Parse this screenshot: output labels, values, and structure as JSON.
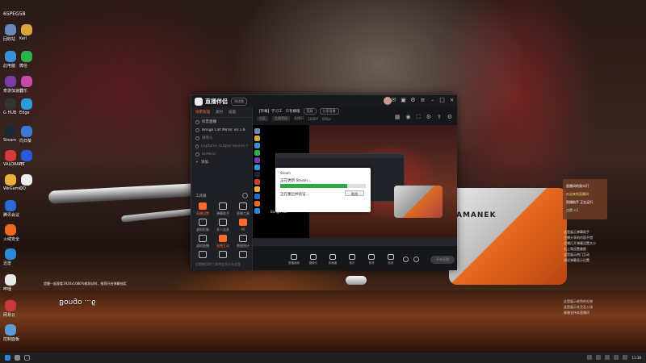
{
  "desktop": {
    "top_label": "65PEG5B",
    "icons": [
      {
        "label": "回收站",
        "color": "#6a87b8"
      },
      {
        "label": "Keil",
        "color": "#d8a53a"
      },
      {
        "label": "此电脑",
        "color": "#3a8fd8"
      },
      {
        "label": "微信",
        "color": "#2bb14a"
      },
      {
        "label": "奇游加速器",
        "color": "#7a3aa8"
      },
      {
        "label": "音乐",
        "color": "#c84aa8"
      },
      {
        "label": "G HUB",
        "color": "#333333"
      },
      {
        "label": "Edge",
        "color": "#2a9ad8"
      },
      {
        "label": "Steam",
        "color": "#1b2838"
      },
      {
        "label": "向日葵",
        "color": "#3a7ad8"
      },
      {
        "label": "VALORANT",
        "color": "#d63a3a"
      },
      {
        "label": "PS",
        "color": "#2a5ad8"
      },
      {
        "label": "WeGame",
        "color": "#e8b03a"
      },
      {
        "label": "QQ",
        "color": "#eeeeee"
      },
      {
        "label": "腾讯会议",
        "color": "#2a6ad8"
      },
      {
        "label": "火绒安全",
        "color": "#e86a1e"
      },
      {
        "label": "迅雷",
        "color": "#2a8ad8"
      },
      {
        "label": "哔哩",
        "color": "#e8e8e8"
      },
      {
        "label": "网易云",
        "color": "#c83a3a"
      },
      {
        "label": "控制面板",
        "color": "#5a9ad8"
      }
    ]
  },
  "app": {
    "name": "直播伴侣",
    "version_badge": "测试版",
    "left_tabs": [
      "场景管理",
      "素材",
      "画面"
    ],
    "scenes": [
      {
        "label": "抖音直播",
        "dim": false
      },
      {
        "label": "Bongo Cat Mirror v0.1.6",
        "dim": false
      },
      {
        "label": "摄像头",
        "dim": true
      },
      {
        "label": "Captures Output Source (Window Capture)",
        "dim": true
      },
      {
        "label": "BONGO",
        "dim": true
      }
    ],
    "add_scene": "添加",
    "tools_title": "工具箱",
    "tools": [
      {
        "label": "直播设置",
        "active": true
      },
      {
        "label": "弹幕助手",
        "active": false
      },
      {
        "label": "直播工具",
        "active": false
      },
      {
        "label": "虚拟形象",
        "active": false
      },
      {
        "label": "多人连麦",
        "active": false
      },
      {
        "label": "PK",
        "active": true
      },
      {
        "label": "虚拟直播",
        "active": false
      },
      {
        "label": "直播互动",
        "active": true
      },
      {
        "label": "数据统计",
        "active": false
      },
      {
        "label": "",
        "active": false
      },
      {
        "label": "",
        "active": false
      },
      {
        "label": "",
        "active": false
      }
    ],
    "left_bottom": "近期使用的工具将会显示在这里",
    "room_title": "【带幕】学习工",
    "room_tag": "只有横版",
    "room_pill": "宽屏",
    "room_pill2": "分享直播",
    "sub_items": [
      "分区",
      "主播等级",
      "直播ID",
      "1080P",
      "60fps"
    ],
    "preview": {
      "steam_title": "Steam",
      "steam_line1": "正在更新 Steam...",
      "steam_line2": "正在重启并验证...",
      "steam_button": "取消",
      "steam_progress": 0.78,
      "label": "Bongo Cat"
    },
    "controls": [
      "直播画面",
      "摄像头",
      "多画面",
      "音乐",
      "音效",
      "贴纸"
    ],
    "live_button": "开始直播"
  },
  "wallpaper": {
    "toy_name": "AMANEK",
    "bongo_text": "Bongo ...6",
    "notice": "提醒一起观看1920x1080%都测试时，推荐开启弹幕抽奖"
  },
  "chat": {
    "top_lines": [
      {
        "text": "直播间的观众们",
        "tone": "w"
      },
      {
        "text": "欢迎来到直播间",
        "tone": "y"
      },
      {
        "text": "直播助手 正在运行",
        "tone": "w"
      },
      {
        "text": "点赞 +1",
        "tone": "g"
      }
    ],
    "mid_lines": [
      "这是展示弹幕助手",
      "主播分享的内容不错",
      "主播打开弹幕设置大小",
      "右上角设置美颜",
      "这是展示热门互动",
      "调试弹幕显示位置"
    ],
    "low_lines": [
      "这是展示收到的礼物",
      "这是展示关注及入场",
      "感谢支持本直播间"
    ]
  },
  "taskbar": {
    "clock": "11:38"
  }
}
